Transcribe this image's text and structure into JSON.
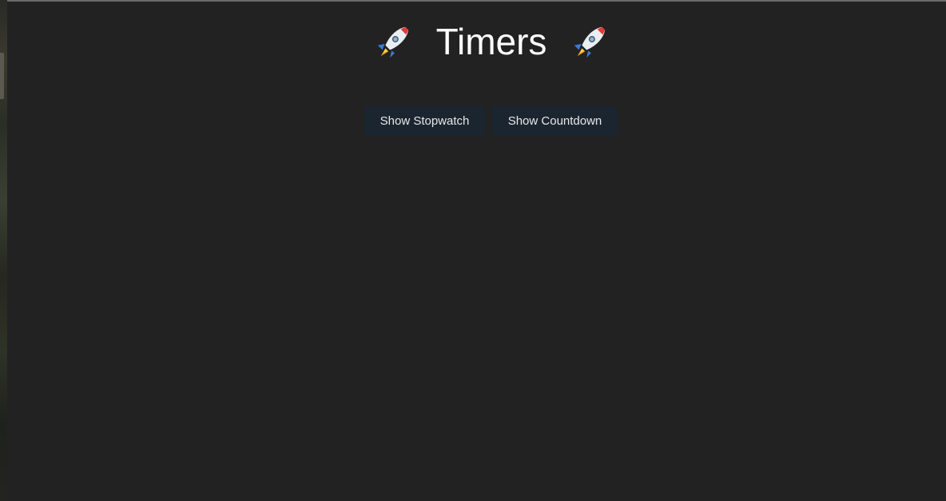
{
  "header": {
    "title": "Timers",
    "left_icon": "rocket-icon",
    "right_icon": "rocket-icon"
  },
  "actions": {
    "stopwatch_label": "Show Stopwatch",
    "countdown_label": "Show Countdown"
  },
  "colors": {
    "background": "#222222",
    "button_bg": "#1b2530",
    "title_text": "#ffffff",
    "button_text": "#e8e8e8"
  }
}
